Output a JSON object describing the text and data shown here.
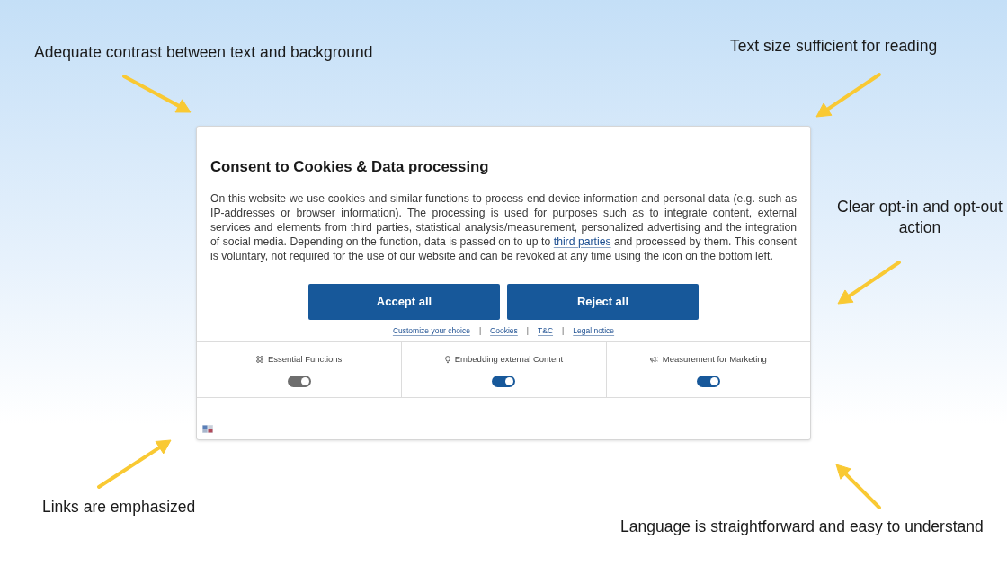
{
  "annotations": [
    {
      "text": "Adequate contrast between text and background"
    },
    {
      "text": "Text size sufficient for reading"
    },
    {
      "text": "Clear opt-in and opt-out action"
    },
    {
      "text": "Links are emphasized"
    },
    {
      "text": "Language is straightforward and easy to understand"
    }
  ],
  "dialog": {
    "title": "Consent to Cookies & Data processing",
    "body": {
      "before": "On this website we use cookies and similar functions to process end device information and personal data (e.g. such as IP-addresses or browser information). The processing is used for purposes such as to integrate content, external services and elements from third parties, statistical analysis/measurement, personalized advertising and the integration of social media. Depending on the function, data is passed on to up to ",
      "link": "third parties",
      "after": " and processed by them. This consent is voluntary, not required for the use of our website and can be revoked at any time using the icon on the bottom left."
    },
    "buttons": [
      {
        "label": "Accept all"
      },
      {
        "label": "Reject all"
      }
    ],
    "links": [
      {
        "kind": "link",
        "text": "Customize your choice"
      },
      {
        "kind": "separator",
        "text": "|"
      },
      {
        "kind": "link",
        "text": "Cookies"
      },
      {
        "kind": "separator",
        "text": "|"
      },
      {
        "kind": "link",
        "text": "T&C"
      },
      {
        "kind": "separator",
        "text": "|"
      },
      {
        "kind": "link",
        "text": "Legal notice"
      }
    ],
    "categories": [
      {
        "label": "Essential Functions",
        "on": true,
        "disabled": true
      },
      {
        "label": "Embedding external Content",
        "on": true,
        "disabled": false
      },
      {
        "label": "Measurement for Marketing",
        "on": true,
        "disabled": false
      }
    ]
  }
}
